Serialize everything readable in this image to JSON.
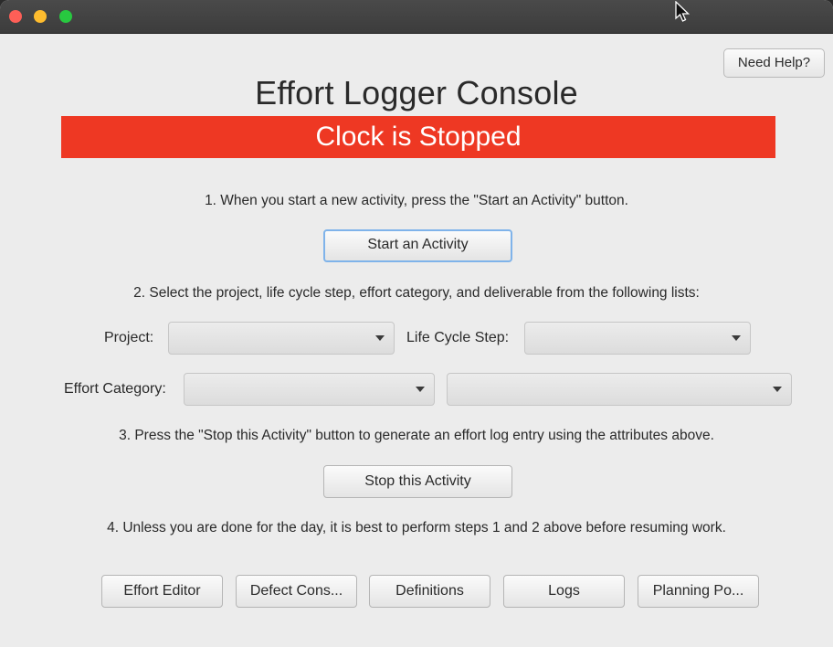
{
  "window": {
    "controls": [
      "close",
      "minimize",
      "zoom"
    ]
  },
  "header": {
    "help_label": "Need Help?",
    "title": "Effort Logger Console",
    "status": "Clock is Stopped",
    "status_color": "#ee3823"
  },
  "steps": {
    "step1": "1. When you start a new activity, press the \"Start an Activity\" button.",
    "start_label": "Start an Activity",
    "step2": "2. Select the project, life cycle step, effort category, and deliverable from the following lists:",
    "step3": "3. Press the \"Stop this Activity\" button to generate an effort log entry using the attributes above.",
    "stop_label": "Stop this Activity",
    "step4": "4. Unless you are done for the day, it is best to perform steps 1 and 2 above before resuming work."
  },
  "selectors": {
    "project_label": "Project:",
    "project_value": "",
    "lifecycle_label": "Life Cycle Step:",
    "lifecycle_value": "",
    "category_label": "Effort Category:",
    "category_value": "",
    "deliverable_value": ""
  },
  "footer": {
    "buttons": [
      "Effort Editor",
      "Defect Cons...",
      "Definitions",
      "Logs",
      "Planning Po..."
    ]
  },
  "icons": {
    "cursor": "mouse-pointer-icon",
    "dropdown": "chevron-down-icon"
  }
}
